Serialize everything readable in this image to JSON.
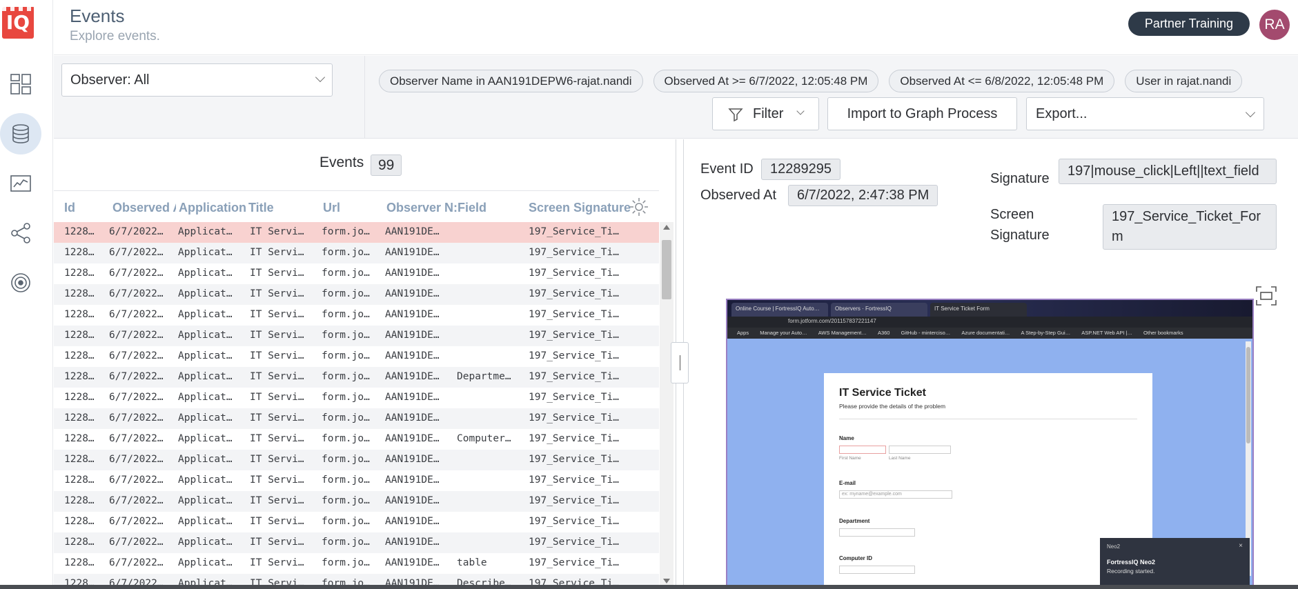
{
  "app": {
    "logo_text": "IQ",
    "brand_color": "#e8473f"
  },
  "rail": {
    "items": [
      {
        "name": "dashboard-icon",
        "active": false
      },
      {
        "name": "database-icon",
        "active": true
      },
      {
        "name": "chart-icon",
        "active": false
      },
      {
        "name": "share-graph-icon",
        "active": false
      },
      {
        "name": "target-icon",
        "active": false
      }
    ]
  },
  "header": {
    "title": "Events",
    "subtitle": "Explore events.",
    "partner_button": "Partner Training",
    "avatar_initials": "RA"
  },
  "toolbar": {
    "observer_select": "Observer: All",
    "chips": [
      "Observer Name in AAN191DEPW6-rajat.nandi",
      "Observed At >= 6/7/2022, 12:05:48 PM",
      "Observed At <= 6/8/2022, 12:05:48 PM",
      "User in rajat.nandi"
    ],
    "filter_label": "Filter",
    "import_label": "Import to Graph Process",
    "export_label": "Export..."
  },
  "events": {
    "count_label": "Events",
    "count": "99",
    "columns": [
      "Id",
      "Observed A",
      "Application",
      "Title",
      "Url",
      "Observer N:",
      "Field",
      "Screen Signature"
    ],
    "rows": [
      {
        "id": "1228…",
        "observed": "6/7/2022…",
        "app": "Applicat…",
        "title": "IT Servi…",
        "url": "form.jo…",
        "observer": "AAN191DE…",
        "field": "",
        "sig": "197_Service_Ti…"
      },
      {
        "id": "1228…",
        "observed": "6/7/2022…",
        "app": "Applicat…",
        "title": "IT Servi…",
        "url": "form.jo…",
        "observer": "AAN191DE…",
        "field": "",
        "sig": "197_Service_Ti…"
      },
      {
        "id": "1228…",
        "observed": "6/7/2022…",
        "app": "Applicat…",
        "title": "IT Servi…",
        "url": "form.jo…",
        "observer": "AAN191DE…",
        "field": "",
        "sig": "197_Service_Ti…"
      },
      {
        "id": "1228…",
        "observed": "6/7/2022…",
        "app": "Applicat…",
        "title": "IT Servi…",
        "url": "form.jo…",
        "observer": "AAN191DE…",
        "field": "",
        "sig": "197_Service_Ti…"
      },
      {
        "id": "1228…",
        "observed": "6/7/2022…",
        "app": "Applicat…",
        "title": "IT Servi…",
        "url": "form.jo…",
        "observer": "AAN191DE…",
        "field": "",
        "sig": "197_Service_Ti…"
      },
      {
        "id": "1228…",
        "observed": "6/7/2022…",
        "app": "Applicat…",
        "title": "IT Servi…",
        "url": "form.jo…",
        "observer": "AAN191DE…",
        "field": "",
        "sig": "197_Service_Ti…"
      },
      {
        "id": "1228…",
        "observed": "6/7/2022…",
        "app": "Applicat…",
        "title": "IT Servi…",
        "url": "form.jo…",
        "observer": "AAN191DE…",
        "field": "",
        "sig": "197_Service_Ti…"
      },
      {
        "id": "1228…",
        "observed": "6/7/2022…",
        "app": "Applicat…",
        "title": "IT Servi…",
        "url": "form.jo…",
        "observer": "AAN191DE…",
        "field": "Departme…",
        "sig": "197_Service_Ti…"
      },
      {
        "id": "1228…",
        "observed": "6/7/2022…",
        "app": "Applicat…",
        "title": "IT Servi…",
        "url": "form.jo…",
        "observer": "AAN191DE…",
        "field": "",
        "sig": "197_Service_Ti…"
      },
      {
        "id": "1228…",
        "observed": "6/7/2022…",
        "app": "Applicat…",
        "title": "IT Servi…",
        "url": "form.jo…",
        "observer": "AAN191DE…",
        "field": "",
        "sig": "197_Service_Ti…"
      },
      {
        "id": "1228…",
        "observed": "6/7/2022…",
        "app": "Applicat…",
        "title": "IT Servi…",
        "url": "form.jo…",
        "observer": "AAN191DE…",
        "field": "Computer…",
        "sig": "197_Service_Ti…"
      },
      {
        "id": "1228…",
        "observed": "6/7/2022…",
        "app": "Applicat…",
        "title": "IT Servi…",
        "url": "form.jo…",
        "observer": "AAN191DE…",
        "field": "",
        "sig": "197_Service_Ti…"
      },
      {
        "id": "1228…",
        "observed": "6/7/2022…",
        "app": "Applicat…",
        "title": "IT Servi…",
        "url": "form.jo…",
        "observer": "AAN191DE…",
        "field": "",
        "sig": "197_Service_Ti…"
      },
      {
        "id": "1228…",
        "observed": "6/7/2022…",
        "app": "Applicat…",
        "title": "IT Servi…",
        "url": "form.jo…",
        "observer": "AAN191DE…",
        "field": "",
        "sig": "197_Service_Ti…"
      },
      {
        "id": "1228…",
        "observed": "6/7/2022…",
        "app": "Applicat…",
        "title": "IT Servi…",
        "url": "form.jo…",
        "observer": "AAN191DE…",
        "field": "",
        "sig": "197_Service_Ti…"
      },
      {
        "id": "1228…",
        "observed": "6/7/2022…",
        "app": "Applicat…",
        "title": "IT Servi…",
        "url": "form.jo…",
        "observer": "AAN191DE…",
        "field": "",
        "sig": "197_Service_Ti…"
      },
      {
        "id": "1228…",
        "observed": "6/7/2022…",
        "app": "Applicat…",
        "title": "IT Servi…",
        "url": "form.jo…",
        "observer": "AAN191DE…",
        "field": "table",
        "sig": "197_Service_Ti…"
      },
      {
        "id": "1228…",
        "observed": "6/7/2022…",
        "app": "Applicat…",
        "title": "IT Servi…",
        "url": "form.jo…",
        "observer": "AAN191DE…",
        "field": "Describe…",
        "sig": "197_Service_Ti…"
      }
    ]
  },
  "detail": {
    "event_id_label": "Event ID",
    "event_id": "12289295",
    "observed_at_label": "Observed At",
    "observed_at": "6/7/2022, 2:47:38 PM",
    "signature_label": "Signature",
    "signature": "197|mouse_click|Left||text_field",
    "screen_signature_label_1": "Screen",
    "screen_signature_label_2": "Signature",
    "screen_signature": "197_Service_Ticket_Form"
  },
  "preview": {
    "tabs": [
      "Online Course | FortressIQ Auto…",
      "Observers · FortressIQ",
      "IT Service Ticket Form"
    ],
    "url": "form.jotform.com/201157837221147",
    "bookmarks": [
      "Apps",
      "Manage your Auto…",
      "AWS Management…",
      "A360",
      "GitHub - minterciso…",
      "Azure documentati…",
      "A Step-by-Step Gui…",
      "ASP.NET Web API |…",
      "Other bookmarks"
    ],
    "form_title": "IT Service Ticket",
    "form_subtitle": "Please provide the details of the problem",
    "name_label": "Name",
    "first_name": "First Name",
    "last_name": "Last Name",
    "email_label": "E-mail",
    "email_placeholder": "ex: myname@example.com",
    "department_label": "Department",
    "computer_id_label": "Computer ID",
    "toast_app": "Neo2",
    "toast_title": "FortressIQ Neo2",
    "toast_text": "Recording started.",
    "toast_close": "×"
  }
}
